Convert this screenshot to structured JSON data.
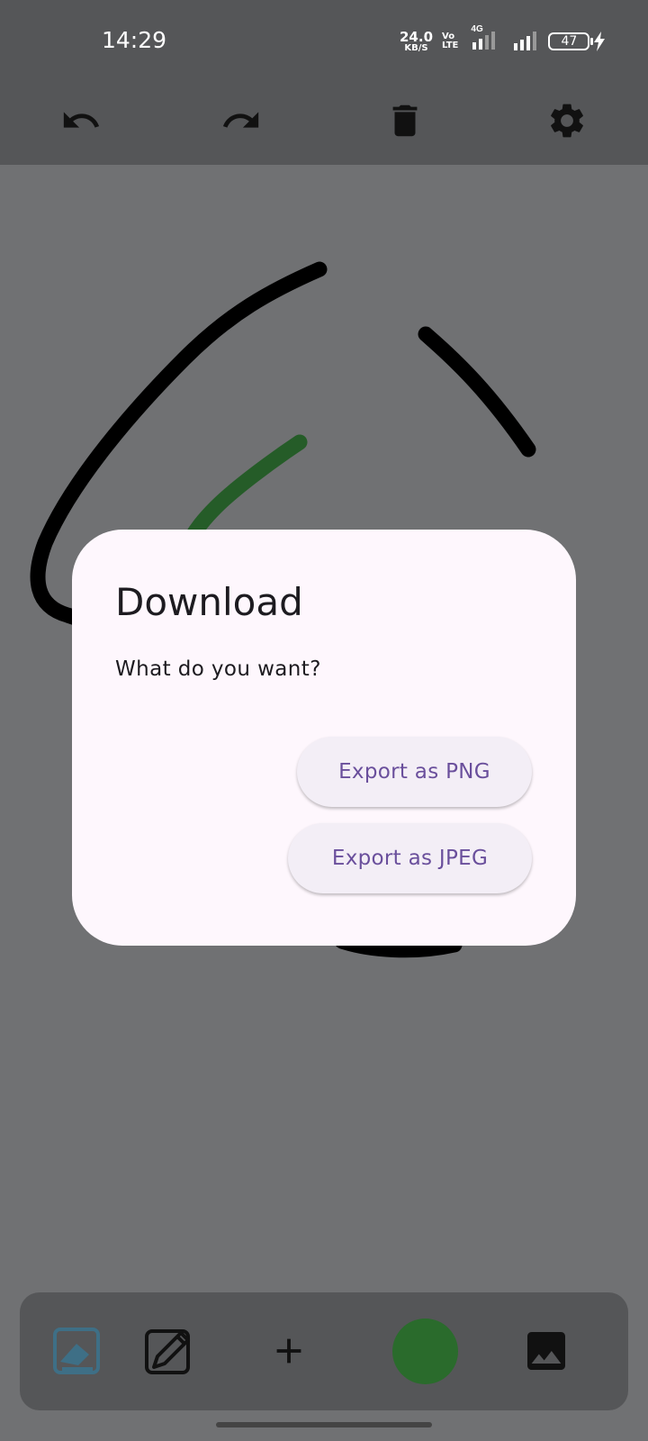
{
  "status_bar": {
    "time": "14:29",
    "net_speed_value": "24.0",
    "net_speed_unit": "KB/S",
    "volte_top": "Vo",
    "volte_bottom": "LTE",
    "network_type": "4G",
    "battery_percent": "47"
  },
  "toolbar": {
    "undo_icon": "undo-icon",
    "redo_icon": "redo-icon",
    "delete_icon": "trash-icon",
    "settings_icon": "gear-icon"
  },
  "bottom_bar": {
    "eraser_icon": "eraser-icon",
    "pen_icon": "pen-icon",
    "add_icon": "plus-icon",
    "image_icon": "image-icon",
    "selected_color": "#2a6b2c"
  },
  "dialog": {
    "title": "Download",
    "message": "What do you want?",
    "export_png_label": "Export as PNG",
    "export_jpeg_label": "Export as JPEG"
  },
  "colors": {
    "background": "#707173",
    "bars": "#555658",
    "dialog_bg": "#fef7fd",
    "button_text": "#6a4f9c",
    "stroke_black": "#000000",
    "stroke_green": "#255c28"
  }
}
